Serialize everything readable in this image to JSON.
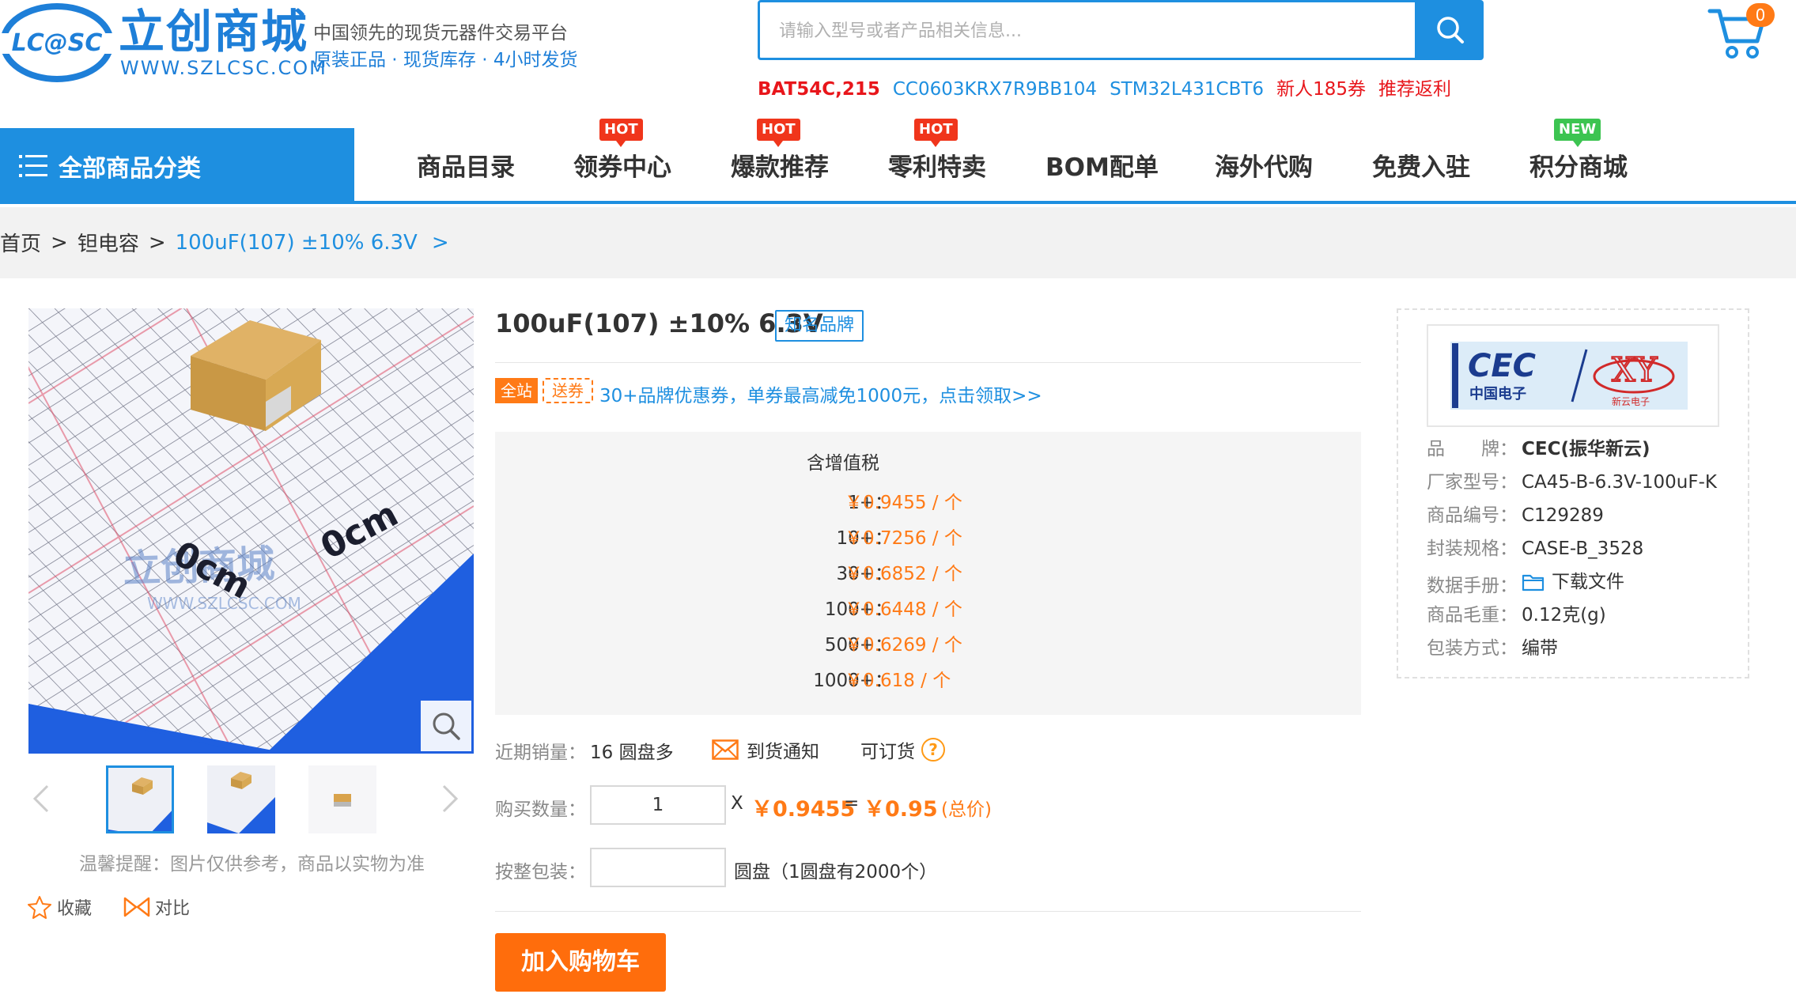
{
  "header": {
    "logo_text": "LC@SC",
    "logo_cn": "立创商城",
    "logo_url": "WWW.SZLCSC.COM",
    "slogan_line1": "中国领先的现货元器件交易平台",
    "slogan_line2": "原装正品 · 现货库存 · 4小时发货",
    "search_placeholder": "请输入型号或者产品相关信息...",
    "hot_keywords": [
      {
        "label": "BAT54C,215",
        "color": "#e8161b",
        "bold": true
      },
      {
        "label": "CC0603KRX7R9BB104",
        "color": "#1e8fe0",
        "bold": false
      },
      {
        "label": "STM32L431CBT6",
        "color": "#1e8fe0",
        "bold": false
      },
      {
        "label": "新人185券",
        "color": "#e8161b",
        "bold": false
      },
      {
        "label": "推荐返利",
        "color": "#e8161b",
        "bold": false
      }
    ],
    "cart_count": "0"
  },
  "nav": {
    "category_label": "全部商品分类",
    "items": [
      {
        "label": "商品目录",
        "badge": ""
      },
      {
        "label": "领券中心",
        "badge": "HOT"
      },
      {
        "label": "爆款推荐",
        "badge": "HOT"
      },
      {
        "label": "零利特卖",
        "badge": "HOT"
      },
      {
        "label": "BOM配单",
        "badge": ""
      },
      {
        "label": "海外代购",
        "badge": ""
      },
      {
        "label": "免费入驻",
        "badge": ""
      },
      {
        "label": "积分商城",
        "badge": "NEW"
      }
    ]
  },
  "breadcrumb": {
    "home": "首页",
    "category": "钽电容",
    "current": "100uF(107) ±10% 6.3V",
    "separator": ">"
  },
  "gallery": {
    "watermark_cn": "立创商城",
    "watermark_url": "WWW.SZLCSC.COM",
    "scale_label_a": "0cm",
    "scale_label_b": "0cm",
    "notice": "温馨提醒：图片仅供参考，商品以实物为准",
    "favorite_label": "收藏",
    "compare_label": "对比"
  },
  "product": {
    "title": "100uF(107) ±10% 6.3V",
    "brand_tag": "知名品牌",
    "coupon_tag_1": "全站",
    "coupon_tag_2": "送券",
    "coupon_link": "30+品牌优惠券，单券最高减免1000元，点击领取>>",
    "price_header": "含增值税",
    "price_tiers": [
      {
        "qty": "1+：",
        "price": "￥0.9455 / 个"
      },
      {
        "qty": "10+：",
        "price": "￥0.7256 / 个"
      },
      {
        "qty": "30+：",
        "price": "￥0.6852 / 个"
      },
      {
        "qty": "100+：",
        "price": "￥0.6448 / 个"
      },
      {
        "qty": "500+：",
        "price": "￥0.6269 / 个"
      },
      {
        "qty": "1000+：",
        "price": "￥0.618 / 个"
      }
    ],
    "sales_label": "近期销量：",
    "sales_value": "16 圆盘多",
    "notify_label": "到货通知",
    "orderable_label": "可订货",
    "quantity_label": "购买数量：",
    "quantity_value": "1",
    "times_sign": "X",
    "unit_price": "￥0.9455",
    "equals_sign": "=",
    "total_price": "￥0.95",
    "total_note": "(总价)",
    "reel_label": "按整包装：",
    "reel_value": "",
    "reel_unit": "圆盘（1圆盘有2000个）",
    "add_cart_label": "加入购物车"
  },
  "brand_panel": {
    "logo_text": "CEC",
    "logo_sub": "中国电子",
    "logo_text_2": "XY",
    "logo_sub_2": "新云电子",
    "specs": [
      {
        "key": "品　　牌：",
        "value": "CEC(振华新云)",
        "bold": true
      },
      {
        "key": "厂家型号：",
        "value": "CA45-B-6.3V-100uF-K",
        "bold": false
      },
      {
        "key": "商品编号：",
        "value": "C129289",
        "bold": false
      },
      {
        "key": "封装规格：",
        "value": "CASE-B_3528",
        "bold": false
      },
      {
        "key": "数据手册：",
        "value": "下载文件",
        "bold": false,
        "icon": "folder-icon"
      },
      {
        "key": "商品毛重：",
        "value": "0.12克(g)",
        "bold": false
      },
      {
        "key": "包装方式：",
        "value": "编带",
        "bold": false
      }
    ]
  },
  "colors": {
    "brand_blue": "#1e8fe0",
    "accent_orange": "#ff7a16",
    "hot_red": "#f0351b",
    "new_green": "#3cc451"
  }
}
